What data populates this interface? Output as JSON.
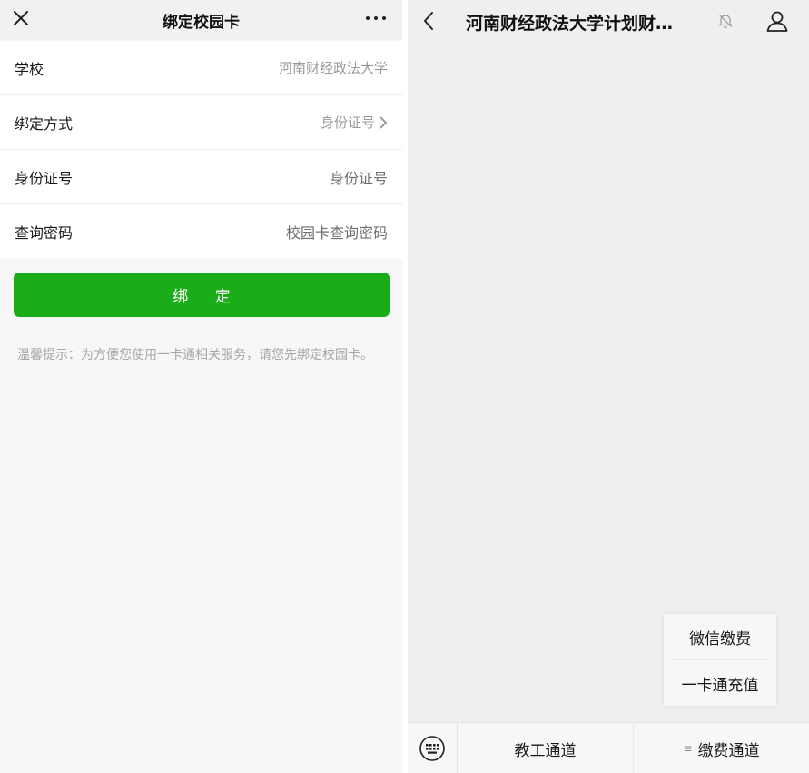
{
  "left": {
    "header": {
      "title": "绑定校园卡",
      "close_icon": "close-icon",
      "more_icon": "more-icon"
    },
    "form": {
      "rows": [
        {
          "label": "学校",
          "value": "河南财经政法大学"
        },
        {
          "label": "绑定方式",
          "value": "身份证号"
        },
        {
          "label": "身份证号",
          "placeholder": "身份证号"
        },
        {
          "label": "查询密码",
          "placeholder": "校园卡查询密码"
        }
      ]
    },
    "bind_button": "绑 定",
    "tip": "温馨提示：为方便您使用一卡通相关服务，请您先绑定校园卡。",
    "accent": "#1aad19"
  },
  "right": {
    "header": {
      "title": "河南财经政法大学计划财…",
      "back_icon": "back-icon",
      "mute_icon": "bell-muted-icon",
      "profile_icon": "profile-icon"
    },
    "popup": {
      "items": [
        "微信缴费",
        "一卡通充值"
      ]
    },
    "bottom_menu": {
      "keyboard_icon": "keyboard-icon",
      "items": [
        {
          "label": "教工通道"
        },
        {
          "label": "缴费通道",
          "icon": "submenu-icon"
        }
      ]
    }
  }
}
